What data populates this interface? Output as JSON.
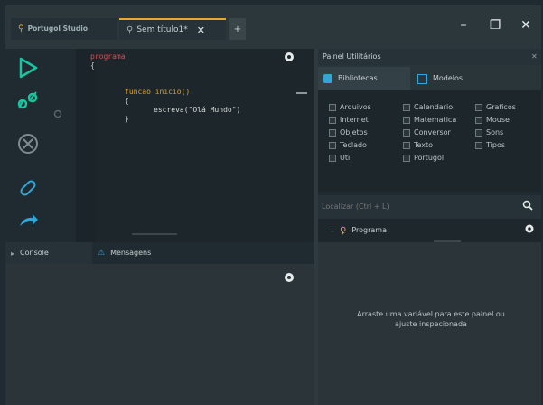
{
  "tabs": [
    {
      "label": "Portugol Studio"
    },
    {
      "label": "Sem título1*",
      "close": "✕"
    }
  ],
  "new_tab": "+",
  "window": {
    "minimize": "–",
    "maximize": "❐",
    "close": "✕"
  },
  "editor": {
    "lines": [
      {
        "text": "programa",
        "color": "#e0484a"
      },
      {
        "text": "{",
        "color": "#c7d0d3"
      },
      {
        "text": "",
        "color": "#c7d0d3"
      },
      {
        "text": "funcao inicio()",
        "color": "#e0a028"
      },
      {
        "text": "{",
        "color": "#c7d0d3"
      },
      {
        "text": "escreva(\"Olá Mundo\")",
        "color": "#c7d0d3"
      },
      {
        "text": "}",
        "color": "#c7d0d3"
      },
      {
        "text": "}",
        "color": "#c7d0d3"
      }
    ]
  },
  "console": {
    "tab_console": "Console",
    "tab_messages": "Mensagens"
  },
  "right": {
    "panel_title": "Painel Utilitários",
    "tab_libraries": "Bibliotecas",
    "tab_models": "Modelos",
    "libraries": [
      "Arquivos",
      "Calendario",
      "Graficos",
      "Internet",
      "Matematica",
      "Mouse",
      "Objetos",
      "Conversor",
      "Sons",
      "Teclado",
      "Texto",
      "Tipos",
      "Util",
      "Portugol"
    ],
    "search_placeholder": "Localizar (Ctrl + L)",
    "tree_item": "Programa",
    "inspector_msg": "Arraste uma variável para este painel ou ajuste inspecionada"
  },
  "colors": {
    "accent": "#f0a626",
    "play": "#17c6a0",
    "link": "#2fa8d8"
  }
}
